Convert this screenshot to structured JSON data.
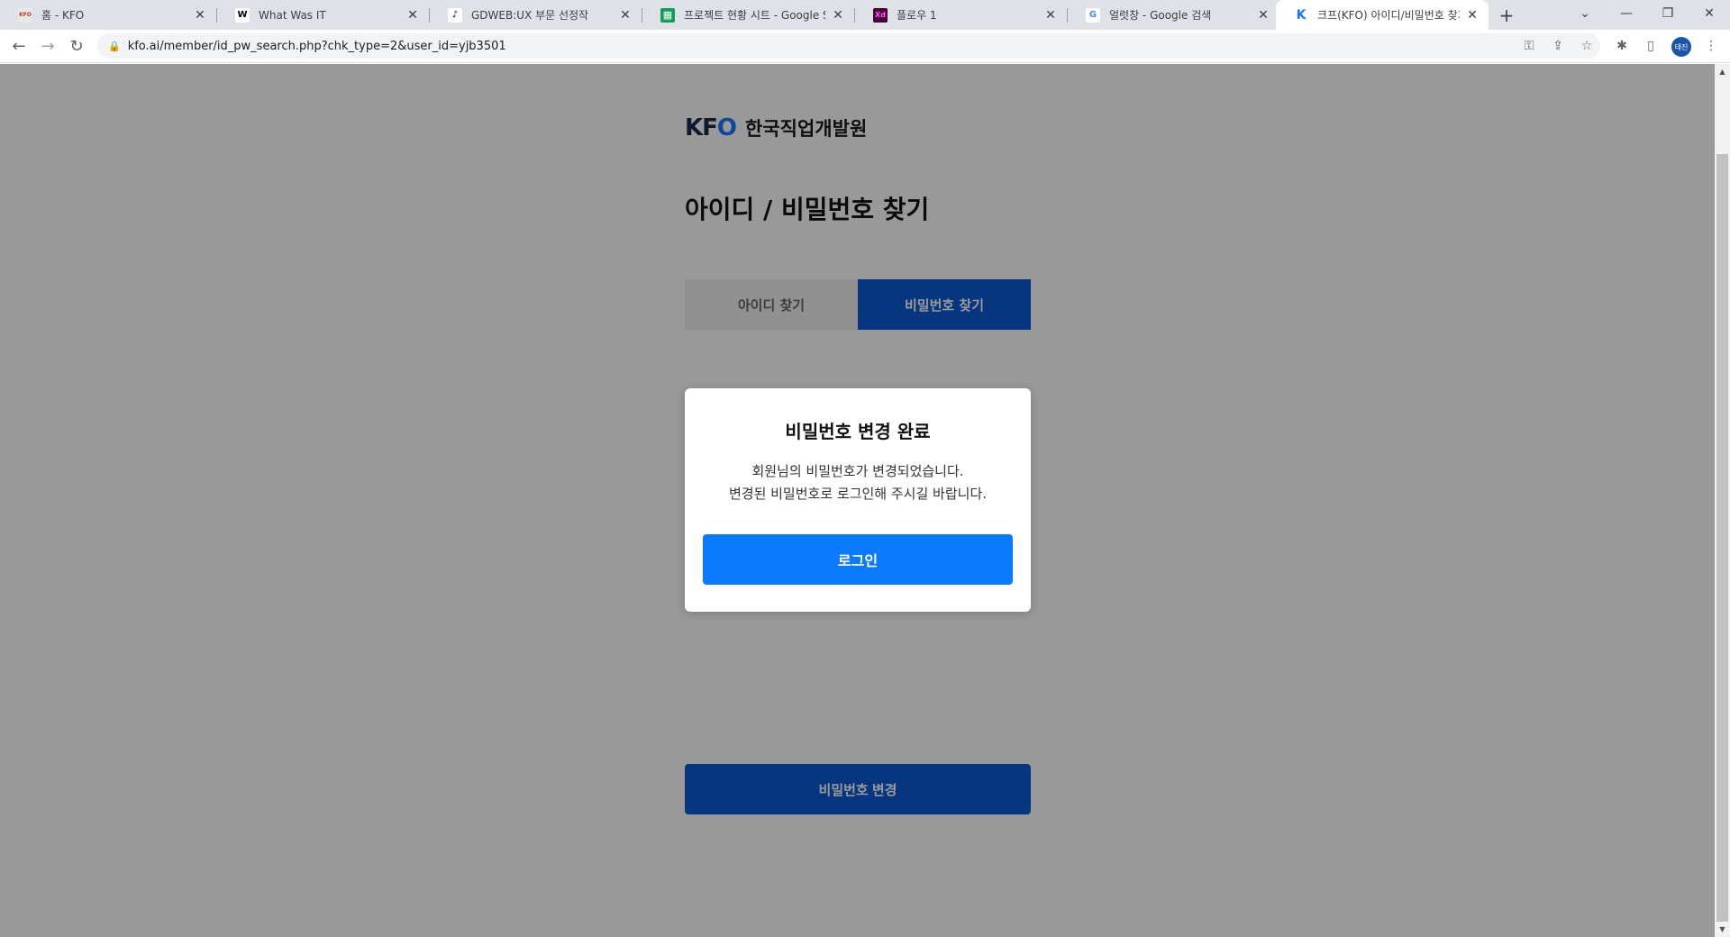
{
  "browser": {
    "tabs": [
      {
        "title": "홈 - KFO",
        "favicon": "kfo-favicon",
        "favicon_text": "KFO",
        "favicon_color": "#e8e8e8",
        "favicon_fg": "#c0392b"
      },
      {
        "title": "What Was IT",
        "favicon": "w-favicon",
        "favicon_text": "W",
        "favicon_color": "#ffffff",
        "favicon_fg": "#000000"
      },
      {
        "title": "GDWEB:UX 부문 선정작",
        "favicon": "tiktok-favicon",
        "favicon_text": "♪",
        "favicon_color": "#ffffff",
        "favicon_fg": "#000000"
      },
      {
        "title": "프로젝트 현황 시트 - Google Sh",
        "favicon": "sheets-favicon",
        "favicon_text": "▦",
        "favicon_color": "#0f9d58",
        "favicon_fg": "#ffffff"
      },
      {
        "title": "플로우 1",
        "favicon": "xd-favicon",
        "favicon_text": "Xd",
        "favicon_color": "#470137",
        "favicon_fg": "#ff61f6"
      },
      {
        "title": "얼럿창 - Google 검색",
        "favicon": "google-favicon",
        "favicon_text": "G",
        "favicon_color": "#ffffff",
        "favicon_fg": "#4285f4"
      },
      {
        "title": "크프(KFO) 아이디/비밀번호 찾기",
        "favicon": "kfo-k-favicon",
        "favicon_text": "K",
        "favicon_color": "#ffffff",
        "favicon_fg": "#1778ff",
        "active": true
      }
    ],
    "new_tab": "+",
    "url": "kfo.ai/member/id_pw_search.php?chk_type=2&user_id=yjb3501",
    "profile_initials": "태진"
  },
  "page": {
    "logo_mark_k": "KF",
    "logo_mark_o": "O",
    "logo_name": "한국직업개발원",
    "title": "아이디 / 비밀번호 찾기",
    "tab_find_id": "아이디 찾기",
    "tab_find_pw": "비밀번호 찾기",
    "change_password_button": "비밀번호 변경"
  },
  "modal": {
    "title": "비밀번호 변경 완료",
    "message_line1": "회원님의 비밀번호가 변경되었습니다.",
    "message_line2": "변경된 비밀번호로 로그인해 주시길 바랍니다.",
    "login_button": "로그인"
  },
  "colors": {
    "primary": "#0a5bd6",
    "login": "#0a7aff",
    "overlay": "rgba(0,0,0,0.4)"
  }
}
